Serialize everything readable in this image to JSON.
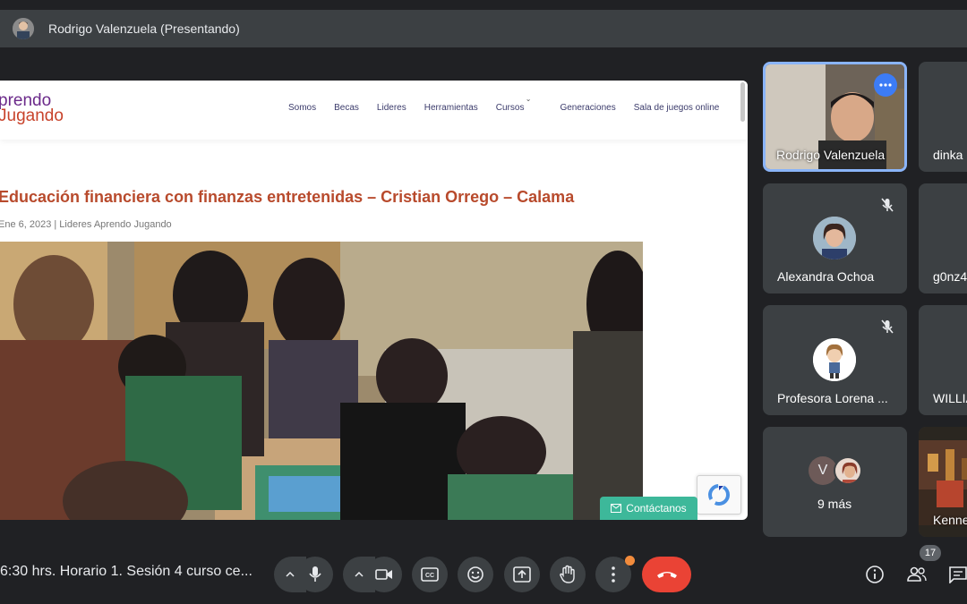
{
  "presenter": {
    "name": "Rodrigo Valenzuela (Presentando)"
  },
  "site": {
    "logo_line1": "prendo",
    "logo_line2": "Jugando",
    "nav": [
      "Somos",
      "Becas",
      "Lideres",
      "Herramientas",
      "Cursos",
      "Generaciones",
      "Sala de juegos online"
    ],
    "article_title": "Educación financiera con finanzas entretenidas – Cristian Orrego – Calama",
    "article_meta": "Ene 6, 2023 | Lideres Aprendo Jugando",
    "contact_label": "Contáctanos"
  },
  "tiles": [
    {
      "name": "Rodrigo Valenzuela"
    },
    {
      "name": "dinka"
    },
    {
      "name": "Alexandra Ochoa"
    },
    {
      "name": "g0nz4"
    },
    {
      "name": "Profesora Lorena ..."
    },
    {
      "name": "WILLIA"
    },
    {
      "name": "9 más",
      "avatar_letter": "V"
    },
    {
      "name": "Kenne"
    }
  ],
  "bottom": {
    "meeting_title": "6:30 hrs. Horario 1. Sesión 4 curso ce...",
    "participants_count": "17"
  },
  "colors": {
    "background": "#202124",
    "tile": "#3c4043",
    "active_border": "#8ab4f8",
    "hangup": "#ea4335",
    "title_orange": "#b84a2c",
    "contact_green": "#3db89a"
  }
}
